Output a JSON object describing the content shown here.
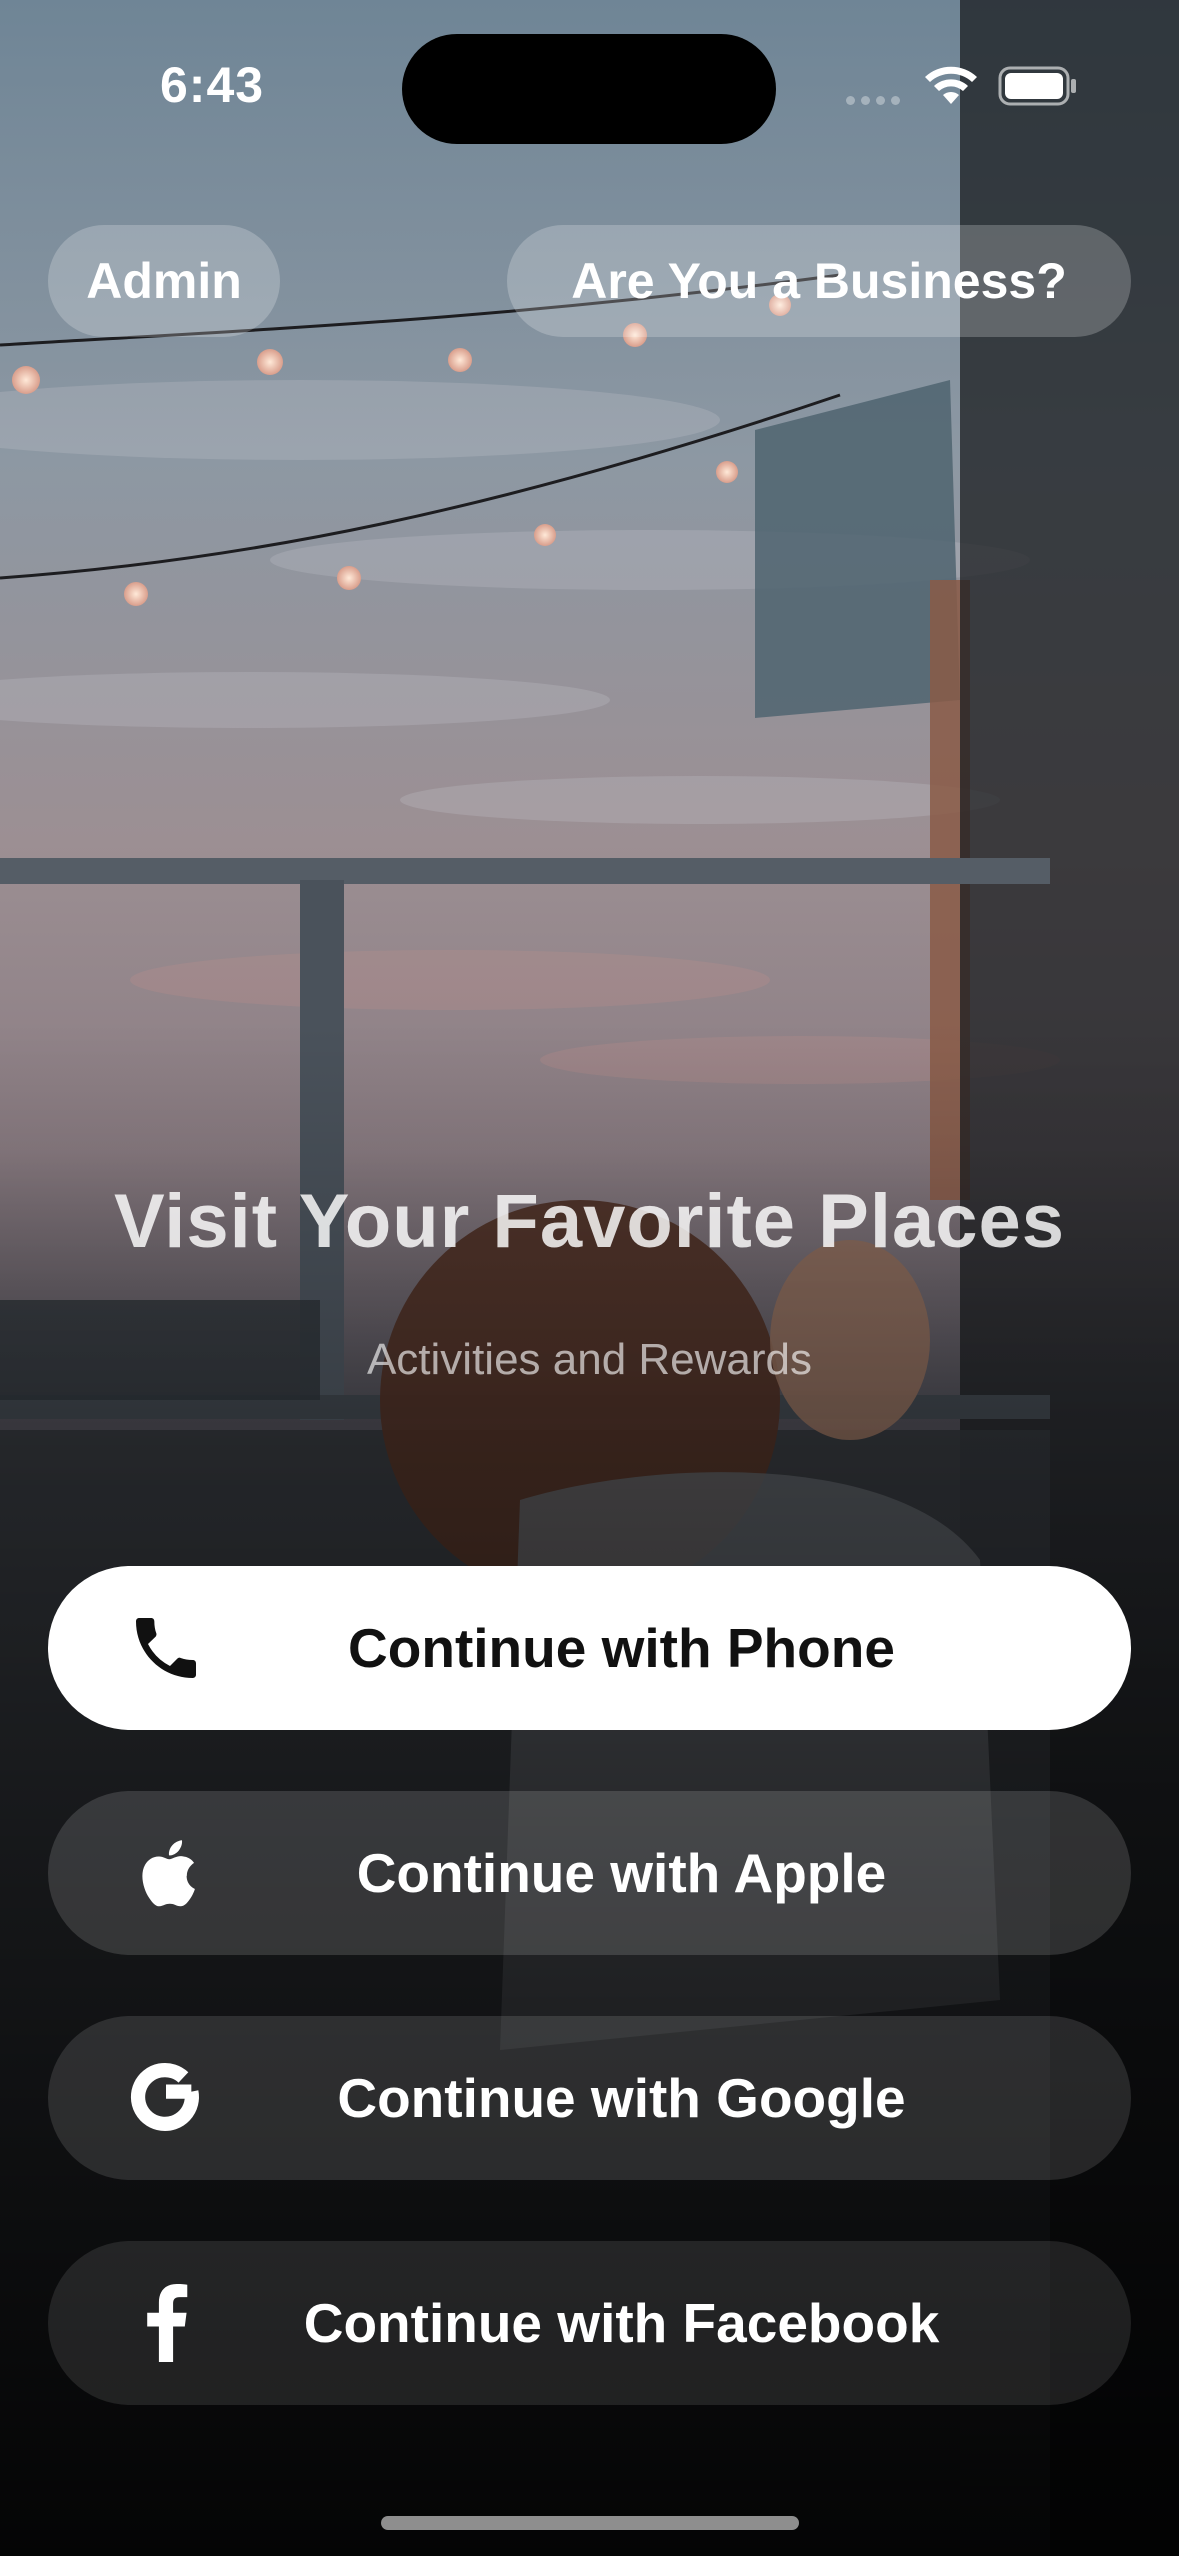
{
  "status_bar": {
    "time": "6:43",
    "wifi_icon": "wifi-icon",
    "battery_icon": "battery-icon"
  },
  "header": {
    "admin_label": "Admin",
    "business_label": "Are You a Business?"
  },
  "hero": {
    "title": "Visit Your Favorite Places",
    "subtitle": "Activities and Rewards"
  },
  "auth": {
    "phone": {
      "label": "Continue with Phone",
      "icon": "phone-icon"
    },
    "apple": {
      "label": "Continue with Apple",
      "icon": "apple-icon"
    },
    "google": {
      "label": "Continue with Google",
      "icon": "google-icon"
    },
    "facebook": {
      "label": "Continue with Facebook",
      "icon": "facebook-icon"
    }
  },
  "colors": {
    "primary_button_bg": "#ffffff",
    "primary_button_text": "#111111",
    "overlay": "#0c0c0e"
  }
}
